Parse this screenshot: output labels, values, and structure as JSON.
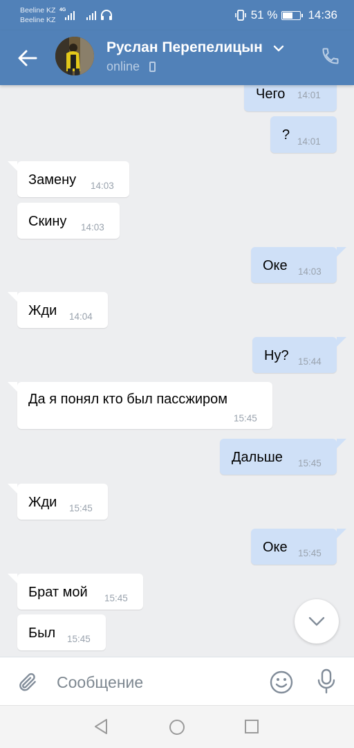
{
  "status_bar": {
    "carrier_1": "Beeline KZ",
    "carrier_2": "Beeline KZ",
    "network_type": "4G",
    "battery_percent": "51 %",
    "battery_level": 0.51,
    "time": "14:36"
  },
  "header": {
    "contact_name": "Руслан Перепелицын",
    "presence": "online",
    "icons": [
      "back-arrow-icon",
      "chevron-down-icon",
      "mobile-device-icon",
      "phone-call-icon"
    ]
  },
  "messages": [
    {
      "side": "out",
      "text": "Чего",
      "time": "14:01"
    },
    {
      "side": "out",
      "text": "?",
      "time": "14:01"
    },
    {
      "side": "in",
      "text": "Замену",
      "time": "14:03"
    },
    {
      "side": "in",
      "text": "Скину",
      "time": "14:03"
    },
    {
      "side": "out",
      "text": "Оке",
      "time": "14:03"
    },
    {
      "side": "in",
      "text": "Жди",
      "time": "14:04"
    },
    {
      "side": "out",
      "text": "Ну?",
      "time": "15:44"
    },
    {
      "side": "in",
      "text": "Да я понял кто был пассжиром",
      "time": "15:45"
    },
    {
      "side": "out",
      "text": "Дальше",
      "time": "15:45"
    },
    {
      "side": "in",
      "text": "Жди",
      "time": "15:45"
    },
    {
      "side": "out",
      "text": "Оке",
      "time": "15:45"
    },
    {
      "side": "in",
      "text": "Брат мой",
      "time": "15:45"
    },
    {
      "side": "in",
      "text": "Был",
      "time": "15:45"
    }
  ],
  "composer": {
    "placeholder": "Сообщение",
    "value": ""
  },
  "colors": {
    "header": "#5181b8",
    "outgoing_bubble": "#cfe0f7",
    "incoming_bubble": "#ffffff",
    "chat_background": "#edeef0"
  }
}
